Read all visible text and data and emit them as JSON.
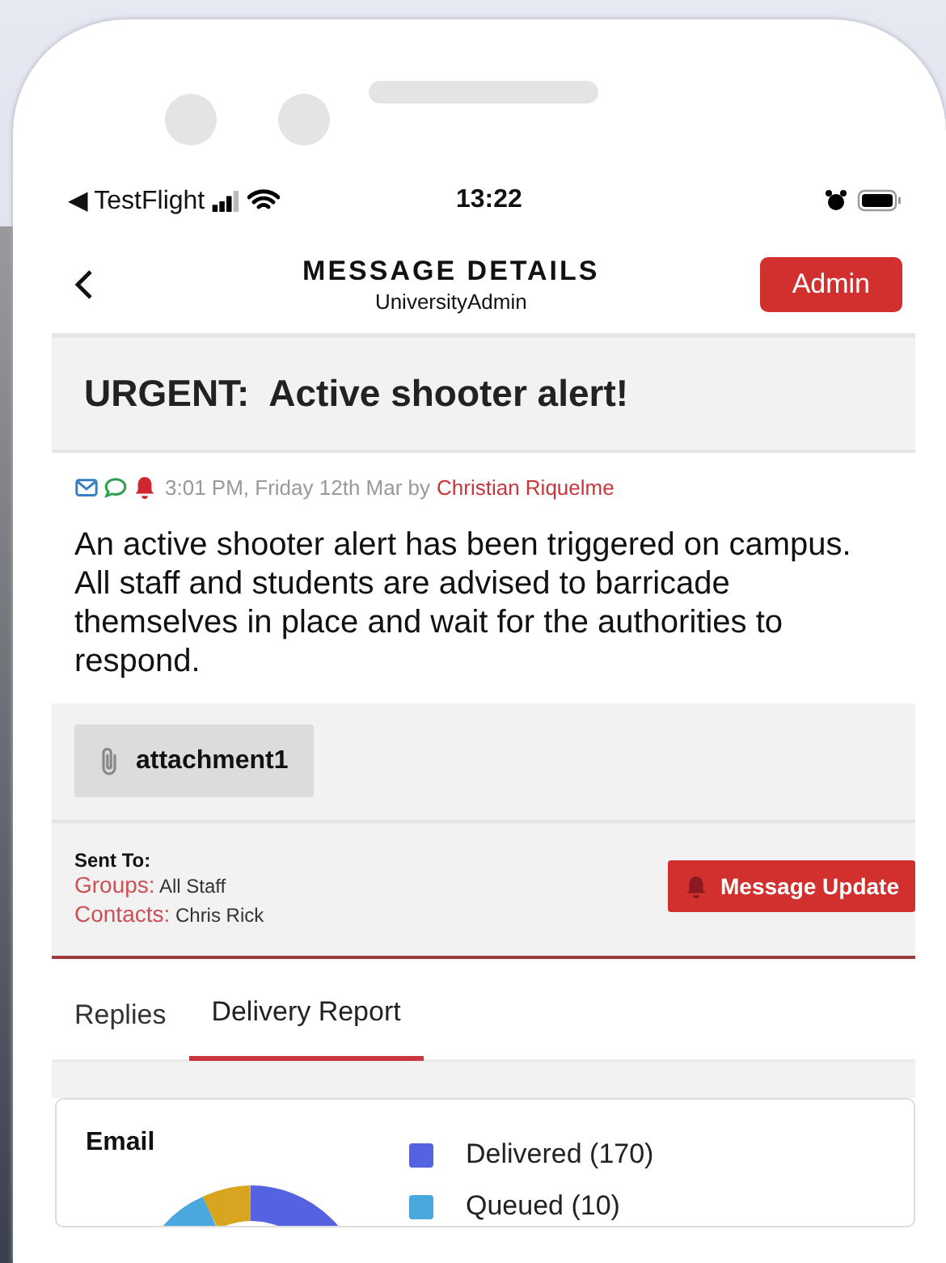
{
  "status_bar": {
    "back_app": "◀ TestFlight",
    "time": "13:22"
  },
  "header": {
    "title": "MESSAGE DETAILS",
    "subtitle": "UniversityAdmin",
    "role_button": "Admin"
  },
  "message": {
    "subject": "URGENT:  Active shooter alert!",
    "channels": [
      {
        "kind": "email",
        "color": "#3a7fc1"
      },
      {
        "kind": "sms",
        "color": "#2e9e4f"
      },
      {
        "kind": "alert",
        "color": "#d0262e"
      }
    ],
    "timestamp": "3:01 PM, Friday 12th Mar by",
    "author": "Christian Riquelme",
    "body": "An active shooter alert has been triggered on campus. All staff and students are advised to barricade themselves in place and wait for the authorities to respond.",
    "attachments": [
      "attachment1"
    ]
  },
  "recipients": {
    "heading": "Sent To:",
    "rows": [
      {
        "label": "Groups:",
        "value": "All Staff"
      },
      {
        "label": "Contacts:",
        "value": "Chris Rick"
      }
    ],
    "update_button": "Message Update"
  },
  "tabs": [
    {
      "label": "Replies",
      "selected": false
    },
    {
      "label": "Delivery Report",
      "selected": true
    }
  ],
  "report": {
    "title": "Email",
    "legend": [
      {
        "label": "Delivered (170)",
        "color": "#5563e0"
      },
      {
        "label": "Queued (10)",
        "color": "#4aa8df"
      }
    ]
  }
}
